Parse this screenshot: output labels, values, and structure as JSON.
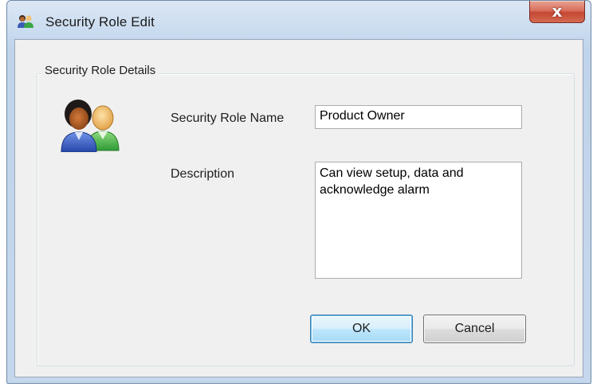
{
  "window": {
    "title": "Security Role Edit",
    "close_glyph": "x",
    "title_icon": "users-icon",
    "accent_close_color": "#c54734"
  },
  "groupbox": {
    "legend": "Security Role Details",
    "role_icon": "security-role-users-icon"
  },
  "form": {
    "name_label": "Security Role Name",
    "name_value": "Product Owner",
    "description_label": "Description",
    "description_value": "Can view setup, data and acknowledge alarm"
  },
  "buttons": {
    "ok": "OK",
    "cancel": "Cancel"
  }
}
